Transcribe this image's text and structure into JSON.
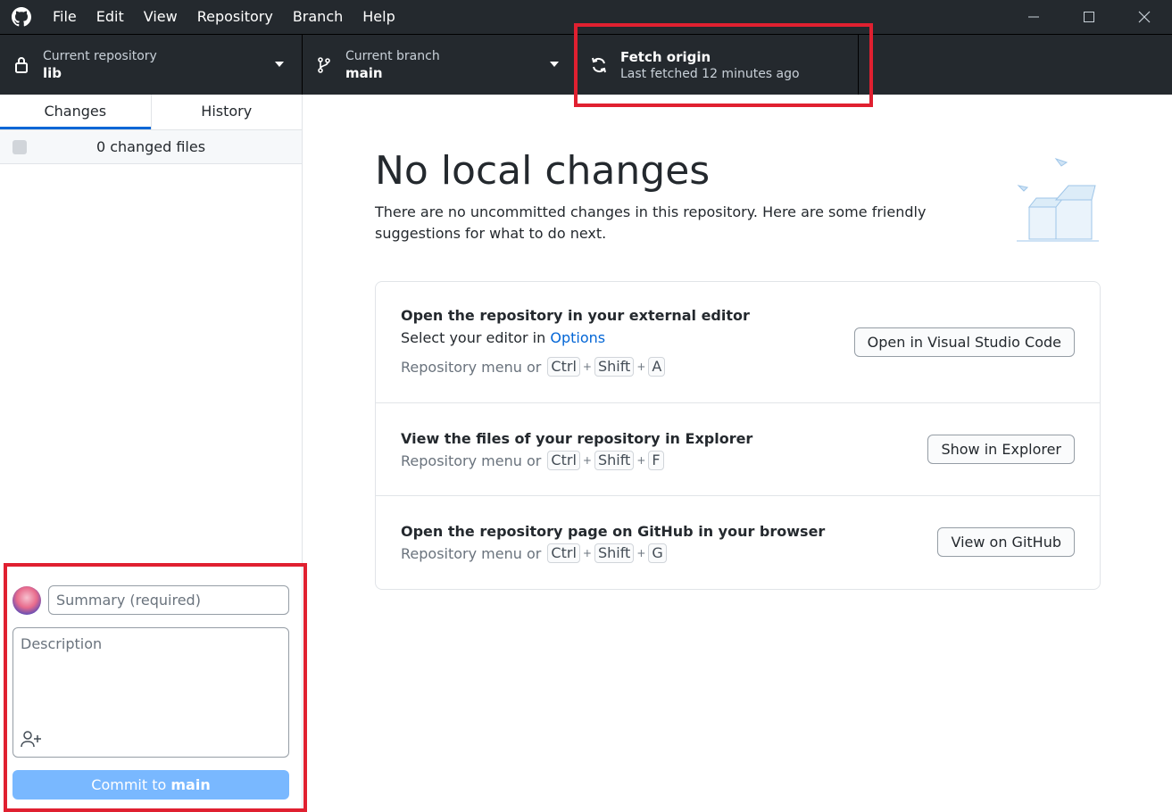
{
  "menu": [
    "File",
    "Edit",
    "View",
    "Repository",
    "Branch",
    "Help"
  ],
  "toolbar": {
    "repo_sub": "Current repository",
    "repo_name": "lib",
    "branch_sub": "Current branch",
    "branch_name": "main",
    "fetch_title": "Fetch origin",
    "fetch_sub": "Last fetched 12 minutes ago"
  },
  "sidebar": {
    "tabs": [
      "Changes",
      "History"
    ],
    "changed_files": "0 changed files",
    "summary_placeholder": "Summary (required)",
    "description_placeholder": "Description",
    "commit_prefix": "Commit to",
    "commit_branch": "main"
  },
  "main": {
    "title": "No local changes",
    "text": "There are no uncommitted changes in this repository. Here are some friendly suggestions for what to do next.",
    "rows": [
      {
        "title": "Open the repository in your external editor",
        "line_prefix": "Select your editor in",
        "line_link": "Options",
        "menu_text": "Repository menu or",
        "keys": [
          "Ctrl",
          "Shift",
          "A"
        ],
        "button": "Open in Visual Studio Code"
      },
      {
        "title": "View the files of your repository in Explorer",
        "menu_text": "Repository menu or",
        "keys": [
          "Ctrl",
          "Shift",
          "F"
        ],
        "button": "Show in Explorer"
      },
      {
        "title": "Open the repository page on GitHub in your browser",
        "menu_text": "Repository menu or",
        "keys": [
          "Ctrl",
          "Shift",
          "G"
        ],
        "button": "View on GitHub"
      }
    ]
  },
  "colors": {
    "titlebar": "#24292e",
    "accent": "#0366d6",
    "commit_button": "#79b8ff",
    "highlight": "#e02030"
  }
}
